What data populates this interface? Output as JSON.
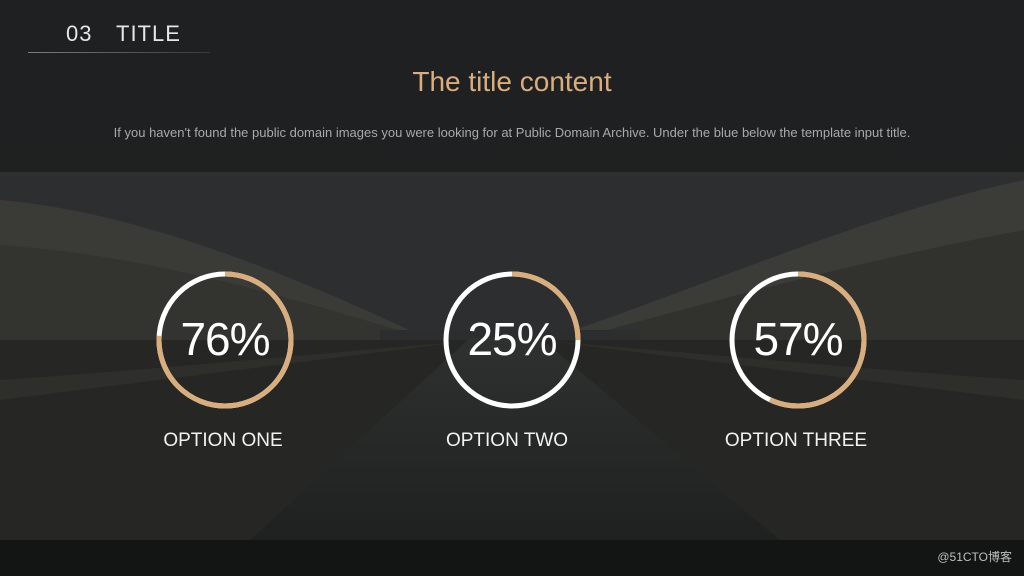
{
  "header": {
    "number": "03",
    "title": "TITLE"
  },
  "main": {
    "title": "The title content",
    "subtitle": "If you haven't found the public domain images you were looking for at Public Domain Archive. Under the blue below the template input title."
  },
  "gauges": [
    {
      "value_text": "76%",
      "percent": 76,
      "label": "OPTION ONE"
    },
    {
      "value_text": "25%",
      "percent": 25,
      "label": "OPTION TWO"
    },
    {
      "value_text": "57%",
      "percent": 57,
      "label": "OPTION THREE"
    }
  ],
  "colors": {
    "accent": "#d9ad7c",
    "ring": "#ffffff",
    "title": "#d9ad7c"
  },
  "watermark": "@51CTO博客"
}
